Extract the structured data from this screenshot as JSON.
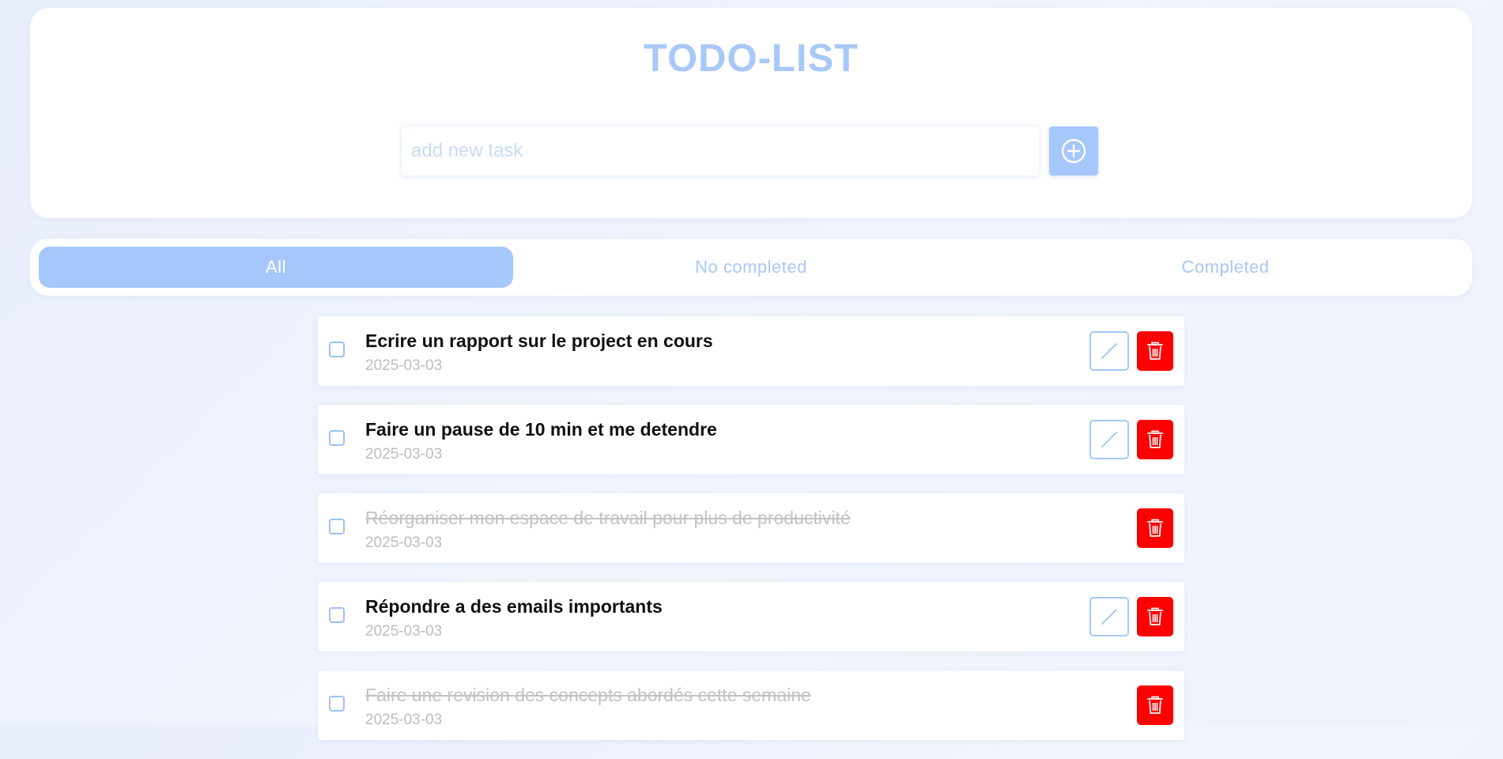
{
  "app": {
    "title": "TODO-LIST"
  },
  "add_task": {
    "placeholder": "add new task",
    "value": ""
  },
  "filters": {
    "tabs": [
      {
        "label": "All",
        "active": true
      },
      {
        "label": "No completed",
        "active": false
      },
      {
        "label": "Completed",
        "active": false
      }
    ]
  },
  "tasks": [
    {
      "text": "Ecrire un rapport sur le project en cours",
      "date": "2025-03-03",
      "completed": false
    },
    {
      "text": "Faire un pause de 10 min et me detendre",
      "date": "2025-03-03",
      "completed": false
    },
    {
      "text": "Réorganiser mon espace de travail pour plus de productivité",
      "date": "2025-03-03",
      "completed": true
    },
    {
      "text": "Répondre a des emails importants",
      "date": "2025-03-03",
      "completed": false
    },
    {
      "text": "Faire une revision des concepts abordés cette semaine",
      "date": "2025-03-03",
      "completed": true
    }
  ],
  "icons": {
    "add": "plus-circle-icon",
    "edit": "pencil-icon",
    "delete": "trash-icon"
  },
  "colors": {
    "accent": "#a6c7fb",
    "delete": "#ff0000",
    "completed_text": "#c2c2c2",
    "date_text": "#bdbdbd"
  }
}
